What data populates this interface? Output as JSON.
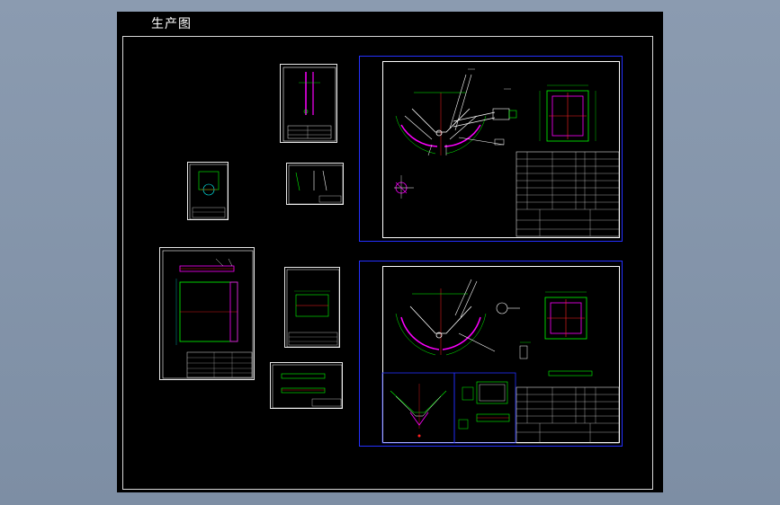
{
  "drawing": {
    "title": "生产图"
  },
  "colors": {
    "background": "#000000",
    "border": "#2430ff",
    "green": "#00ff00",
    "magenta": "#ff00ff",
    "red": "#ff2020",
    "yellow": "#ffff00",
    "cyan": "#00ffff",
    "white": "#ffffff"
  },
  "sheets": [
    {
      "name": "sheet-small-1"
    },
    {
      "name": "sheet-small-2"
    },
    {
      "name": "sheet-small-3"
    },
    {
      "name": "sheet-medium-1"
    },
    {
      "name": "sheet-small-4"
    },
    {
      "name": "sheet-small-5"
    },
    {
      "name": "sheet-large-assembly-1"
    },
    {
      "name": "sheet-large-assembly-2"
    }
  ]
}
